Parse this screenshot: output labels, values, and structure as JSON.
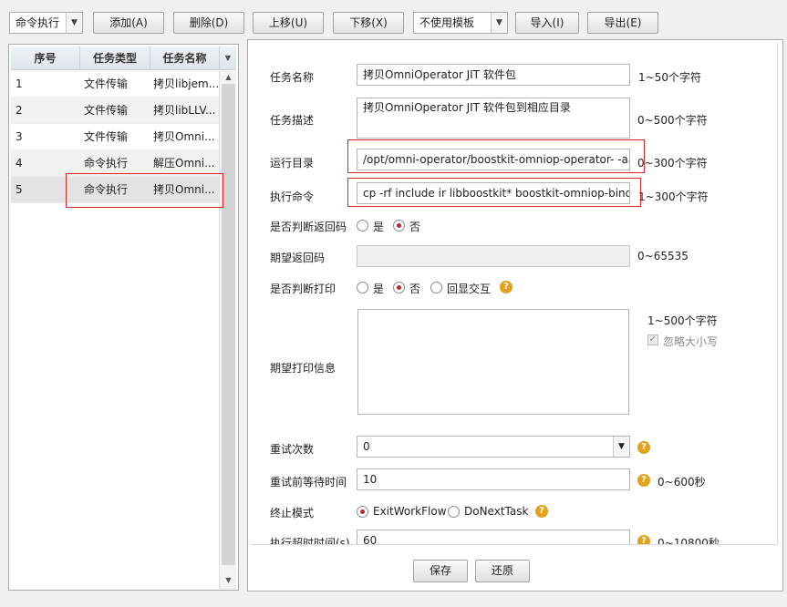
{
  "toolbar": {
    "mode_select": "命令执行",
    "add": "添加(A)",
    "delete": "删除(D)",
    "move_up": "上移(U)",
    "move_down": "下移(X)",
    "template_select": "不使用模板",
    "import": "导入(I)",
    "export": "导出(E)"
  },
  "task_list": {
    "headers": [
      "序号",
      "任务类型",
      "任务名称"
    ],
    "rows": [
      {
        "no": "1",
        "type": "文件传输",
        "name": "拷贝libjem..."
      },
      {
        "no": "2",
        "type": "文件传输",
        "name": "拷贝libLLV..."
      },
      {
        "no": "3",
        "type": "文件传输",
        "name": "拷贝Omni..."
      },
      {
        "no": "4",
        "type": "命令执行",
        "name": "解压Omni..."
      },
      {
        "no": "5",
        "type": "命令执行",
        "name": "拷贝Omni..."
      }
    ]
  },
  "form": {
    "task_name": {
      "label": "任务名称",
      "value": "拷贝OmniOperator JIT 软件包",
      "hint": "1~50个字符"
    },
    "task_desc": {
      "label": "任务描述",
      "value": "拷贝OmniOperator JIT 软件包到相应目录",
      "hint": "0~500个字符"
    },
    "run_dir": {
      "label": "运行目录",
      "value": "/opt/omni-operator/boostkit-omniop-operator-      -aa",
      "hint": "0~300个字符"
    },
    "command": {
      "label": "执行命令",
      "value": "cp -rf include ir libboostkit* boostkit-omniop-bindings*",
      "hint": "1~300个字符"
    },
    "check_return": {
      "label": "是否判断返回码",
      "yes": "是",
      "no": "否",
      "selected": "否"
    },
    "expected_code": {
      "label": "期望返回码",
      "value": "",
      "hint": "0~65535"
    },
    "check_print": {
      "label": "是否判断打印",
      "yes": "是",
      "no": "否",
      "echo": "回显交互",
      "selected": "否"
    },
    "expected_print": {
      "label": "期望打印信息",
      "value": "",
      "hint": "1~500个字符",
      "ignore_case": "忽略大小写",
      "ignore_case_checked": true
    },
    "retry_count": {
      "label": "重试次数",
      "value": "0"
    },
    "retry_wait": {
      "label": "重试前等待时间",
      "value": "10",
      "hint": "0~600秒"
    },
    "stop_mode": {
      "label": "终止模式",
      "opt1": "ExitWorkFlow",
      "opt2": "DoNextTask",
      "selected": "ExitWorkFlow"
    },
    "timeout": {
      "label": "执行超时时间(s)",
      "value": "60",
      "hint": "0~10800秒"
    }
  },
  "footer": {
    "save": "保存",
    "restore": "还原"
  },
  "icons": {
    "help": "help-icon",
    "dropdown": "chevron-down-icon",
    "scroll_up": "arrow-up-icon",
    "scroll_down": "arrow-down-icon",
    "collapse": "double-chevron-down-icon"
  },
  "colors": {
    "highlight_box": "#d9282b",
    "radio_selected": "#c0262b",
    "help_icon": "#e4a11b"
  }
}
